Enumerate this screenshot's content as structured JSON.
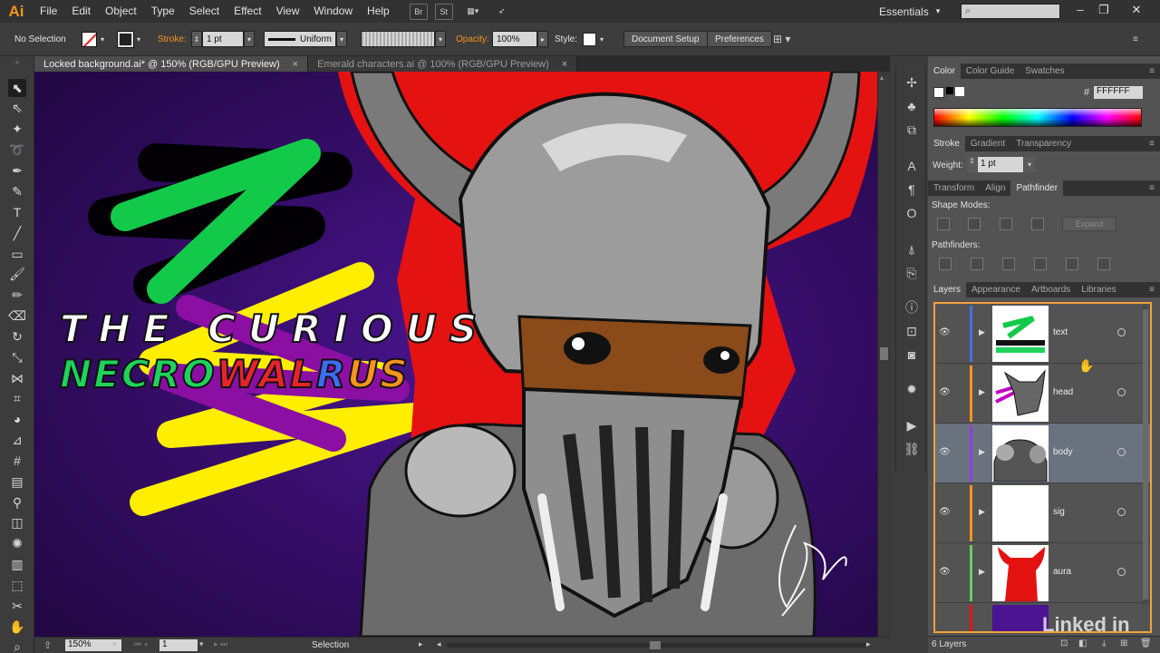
{
  "app": {
    "logo": "Ai"
  },
  "menu": [
    "File",
    "Edit",
    "Object",
    "Type",
    "Select",
    "Effect",
    "View",
    "Window",
    "Help"
  ],
  "menu_buttons": [
    "Br",
    "St"
  ],
  "workspace": "Essentials",
  "control": {
    "selection": "No Selection",
    "stroke_label": "Stroke:",
    "stroke_value": "1 pt",
    "profile": "Uniform",
    "opacity_label": "Opacity:",
    "opacity_value": "100%",
    "style_label": "Style:",
    "document_setup": "Document Setup",
    "preferences": "Preferences"
  },
  "tabs": [
    {
      "label": "Locked background.ai* @ 150% (RGB/GPU Preview)",
      "active": true
    },
    {
      "label": "Emerald characters.ai @ 100% (RGB/GPU Preview)",
      "active": false
    }
  ],
  "artwork": {
    "line1": "THE CURIOUS",
    "line2_parts": [
      {
        "text": "NECRO",
        "color": "#1fd35a"
      },
      {
        "text": "WAL",
        "color": "#e8242a"
      },
      {
        "text": "R",
        "color": "#3d6df0"
      },
      {
        "text": "US",
        "color": "#f7941e"
      }
    ]
  },
  "status": {
    "zoom": "150%",
    "page": "1",
    "tool": "Selection"
  },
  "color_panel": {
    "tabs": [
      "Color",
      "Color Guide",
      "Swatches"
    ],
    "hex_symbol": "#",
    "hex_value": "FFFFFF"
  },
  "stroke_panel": {
    "tabs": [
      "Stroke",
      "Gradient",
      "Transparency"
    ],
    "weight_label": "Weight:",
    "weight_value": "1 pt"
  },
  "pathfinder_panel": {
    "tabs": [
      "Transform",
      "Align",
      "Pathfinder"
    ],
    "shape_modes_label": "Shape Modes:",
    "expand_label": "Expand",
    "pathfinders_label": "Pathfinders:"
  },
  "layers_panel": {
    "tabs": [
      "Layers",
      "Appearance",
      "Artboards",
      "Libraries"
    ],
    "layers": [
      {
        "name": "text",
        "color": "#4a6fe3"
      },
      {
        "name": "head",
        "color": "#f7941e"
      },
      {
        "name": "body",
        "color": "#8e3fe0"
      },
      {
        "name": "sig",
        "color": "#f7941e"
      },
      {
        "name": "aura",
        "color": "#5fd35a"
      }
    ],
    "count": "6 Layers"
  },
  "watermark": "Linked in"
}
